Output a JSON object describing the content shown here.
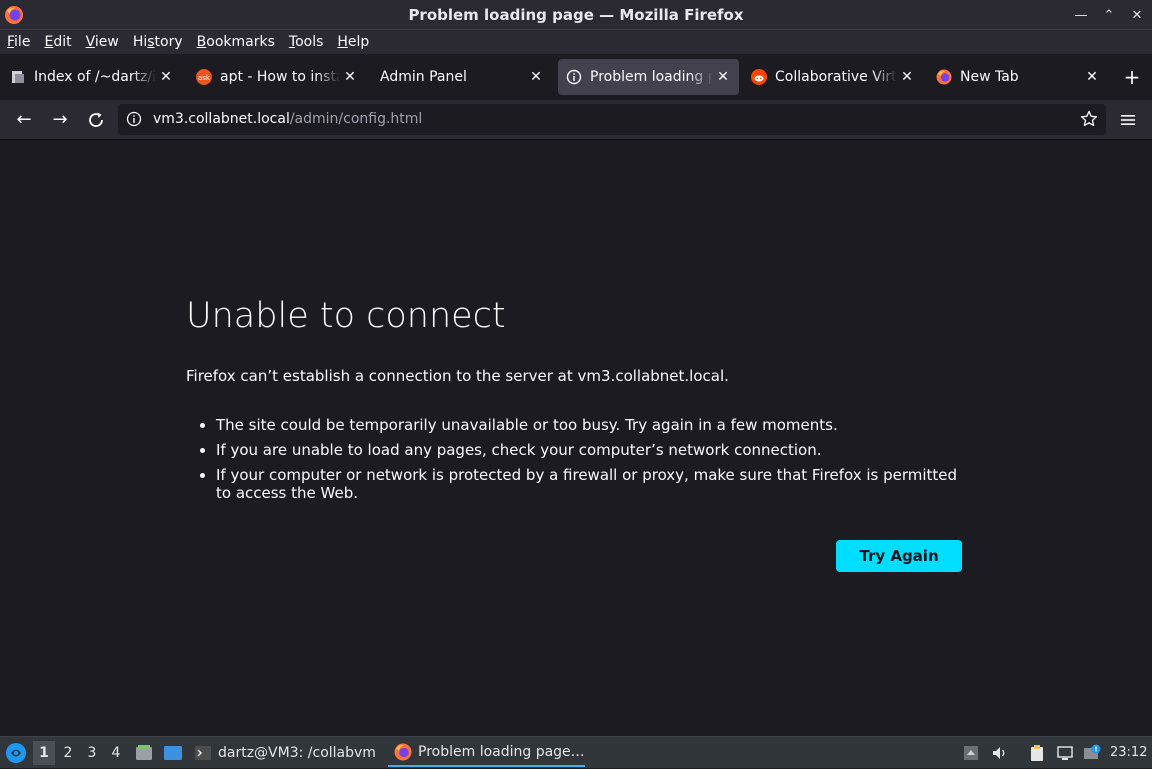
{
  "window": {
    "title": "Problem loading page — Mozilla Firefox",
    "controls": [
      "minimize",
      "maximize",
      "close"
    ]
  },
  "menubar": [
    {
      "label": "File",
      "mnemonic": "F",
      "rest": "ile"
    },
    {
      "label": "Edit",
      "mnemonic": "E",
      "rest": "dit"
    },
    {
      "label": "View",
      "mnemonic": "V",
      "rest": "iew"
    },
    {
      "label": "History",
      "mnemonic": "s",
      "pre": "Hi",
      "rest": "tory"
    },
    {
      "label": "Bookmarks",
      "mnemonic": "B",
      "rest": "ookmarks"
    },
    {
      "label": "Tools",
      "mnemonic": "T",
      "rest": "ools"
    },
    {
      "label": "Help",
      "mnemonic": "H",
      "rest": "elp"
    }
  ],
  "tabs": [
    {
      "label": "Index of /~dartz/iso",
      "icon": "directory-icon"
    },
    {
      "label": "apt - How to install",
      "icon": "askubuntu-icon"
    },
    {
      "label": "Admin Panel",
      "icon": ""
    },
    {
      "label": "Problem loading page",
      "icon": "info-icon",
      "active": true
    },
    {
      "label": "Collaborative Virtual",
      "icon": "reddit-icon"
    },
    {
      "label": "New Tab",
      "icon": "firefox-icon"
    }
  ],
  "navbar": {
    "url_host": "vm3.collabnet.local",
    "url_path": "/admin/config.html"
  },
  "error": {
    "title": "Unable to connect",
    "description": "Firefox can’t establish a connection to the server at vm3.collabnet.local.",
    "bullets": [
      "The site could be temporarily unavailable or too busy. Try again in a few moments.",
      "If you are unable to load any pages, check your computer’s network connection.",
      "If your computer or network is protected by a firewall or proxy, make sure that Firefox is permitted to access the Web."
    ],
    "button": "Try Again",
    "accent": "#00ddff"
  },
  "taskbar": {
    "workspaces": [
      "1",
      "2",
      "3",
      "4"
    ],
    "tasks": [
      {
        "label": "dartz@VM3: /collabvm",
        "icon": "terminal-icon"
      },
      {
        "label": "Problem loading page…",
        "icon": "firefox-icon",
        "active": true
      }
    ],
    "clock": "23:12"
  }
}
